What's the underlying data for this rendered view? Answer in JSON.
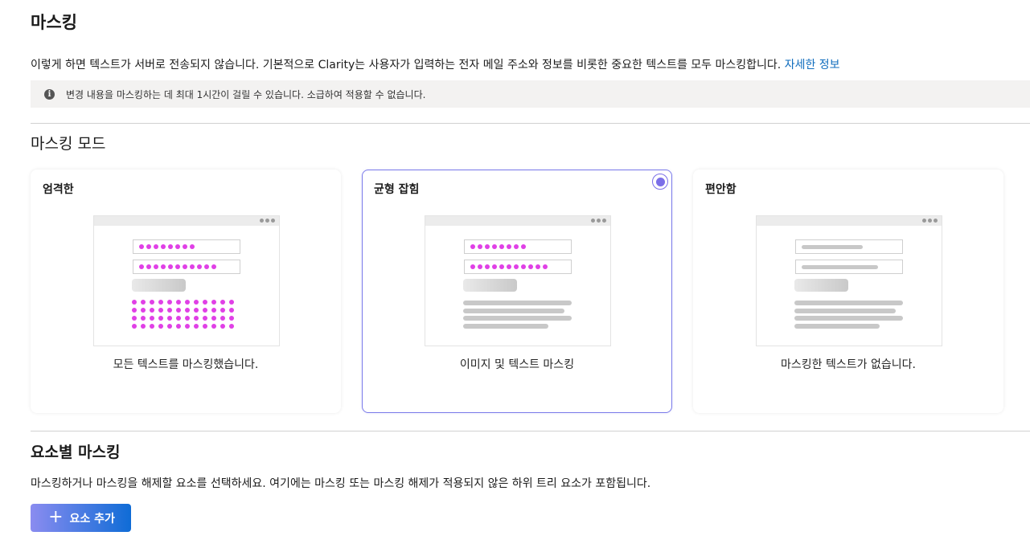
{
  "page": {
    "title": "마스킹",
    "description": "이렇게 하면 텍스트가 서버로 전송되지 않습니다. 기본적으로 Clarity는 사용자가 입력하는 전자 메일 주소와 정보를 비롯한 중요한 텍스트를 모두 마스킹합니다. ",
    "learn_more": "자세한 정보",
    "info_icon": "info-icon",
    "info": "변경 내용을 마스킹하는 데 최대 1시간이 걸릴 수 있습니다. 소급하여 적용할 수 없습니다."
  },
  "mode_section": {
    "title": "마스킹 모드",
    "selected": "balanced",
    "cards": [
      {
        "id": "strict",
        "title": "엄격한",
        "caption": "모든 텍스트를 마스킹했습니다."
      },
      {
        "id": "balanced",
        "title": "균형 잡힘",
        "caption": "이미지 및 텍스트 마스킹"
      },
      {
        "id": "relaxed",
        "title": "편안함",
        "caption": "마스킹한 텍스트가 없습니다."
      }
    ]
  },
  "element_section": {
    "title": "요소별 마스킹",
    "description": "마스킹하거나 마스킹을 해제할 요소를 선택하세요. 여기에는 마스킹 또는 마스킹 해제가 적용되지 않은 하위 트리 요소가 포함됩니다.",
    "add_button": "요소 추가",
    "add_icon": "plus-icon"
  },
  "colors": {
    "accent": "#7b6fe8",
    "link": "#0f6cbd",
    "mask_dot": "#e040e6",
    "button_gradient_start": "#8a8cf0",
    "button_gradient_end": "#0f6cd6"
  }
}
